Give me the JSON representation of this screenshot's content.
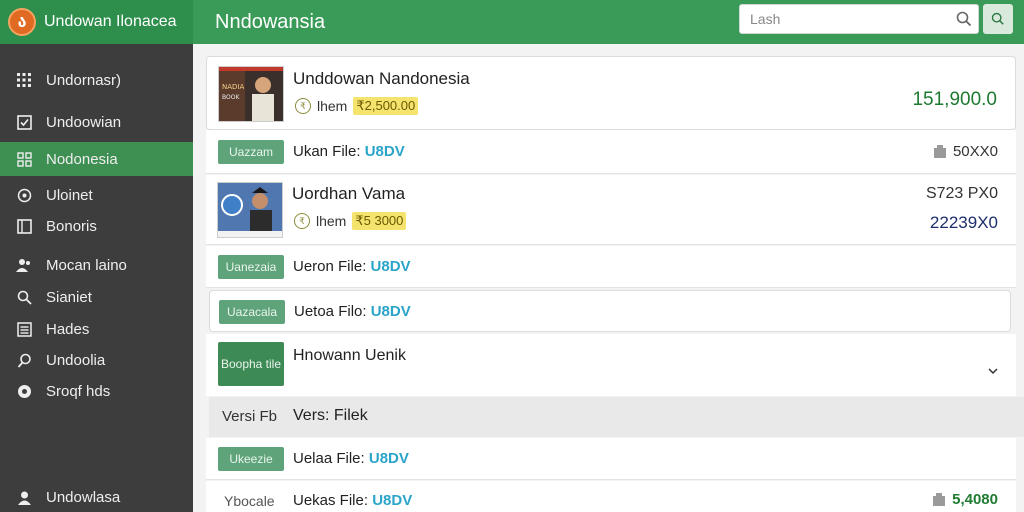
{
  "app": {
    "brand_name": "Undowan Ilonacea",
    "header_title": "Nndowansia"
  },
  "search": {
    "placeholder": "Lash"
  },
  "sidebar": {
    "items": [
      {
        "label": "Undornasr)",
        "icon": "grid-icon",
        "active": false
      },
      {
        "label": "Undoowian",
        "icon": "checkbox-icon",
        "active": false
      },
      {
        "label": "Nodonesia",
        "icon": "apps-icon",
        "active": true
      },
      {
        "label": "Uloinet",
        "icon": "clock-icon",
        "active": false
      },
      {
        "label": "Bonoris",
        "icon": "window-icon",
        "active": false
      },
      {
        "label": "Mocan laino",
        "icon": "people-icon",
        "active": false
      },
      {
        "label": "Sianiet",
        "icon": "search-icon",
        "active": false
      },
      {
        "label": "Hades",
        "icon": "list-icon",
        "active": false
      },
      {
        "label": "Undoolia",
        "icon": "pin-icon",
        "active": false
      },
      {
        "label": "Sroqf hds",
        "icon": "shield-icon",
        "active": false
      }
    ],
    "footer_label": "Undowlasa"
  },
  "list": {
    "product1": {
      "title": "Unddowan Nandonesia",
      "item_label": "lhem",
      "price": "₹2,500.00",
      "amount": "151,900.0"
    },
    "file1": {
      "button": "Uazzam",
      "label": "Ukan File: ",
      "value": "U8DV",
      "stat": "50XX0"
    },
    "product2": {
      "title": "Uordhan Vama",
      "item_label": "lhem",
      "price": "₹5 3000",
      "amount_top": "S723 PX0",
      "amount_bottom": "22239X0"
    },
    "file2": {
      "button": "Uanezaia",
      "label": "Ueron File: ",
      "value": "U8DV"
    },
    "file3": {
      "button": "Uazacala",
      "label": "Uetoa Filo: ",
      "value": "U8DV"
    },
    "expand": {
      "button": "Boopha tile",
      "title": "Hnowann Uenik"
    },
    "version": {
      "left": "Versi Fb",
      "label": "Vers: Filek"
    },
    "file4": {
      "button": "Ukeezie",
      "label": "Uelaa File: ",
      "value": "U8DV"
    },
    "file5": {
      "button": "Ybocale",
      "label": "Uekas File: ",
      "value": "U8DV",
      "stat": "5,4080"
    }
  },
  "colors": {
    "brand_green": "#2e8f4c",
    "sidebar_bg": "#3d3d3d",
    "amount_green": "#1f7a32",
    "amount_navy": "#1d2f6b",
    "link_blue": "#2aa4c9"
  }
}
